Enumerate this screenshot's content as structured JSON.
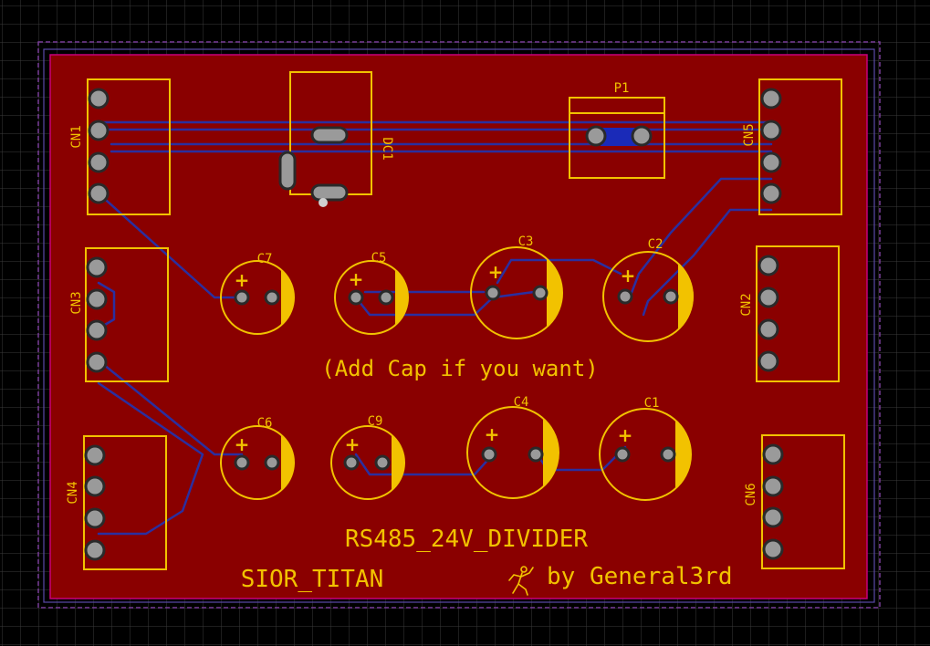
{
  "board": {
    "title": "RS485_24V_DIVIDER",
    "project": "SIOR_TITAN",
    "author": "by General3rd",
    "note": "(Add Cap if you want)",
    "logo_icon": "running-figure-icon"
  },
  "connectors": [
    "CN1",
    "CN2",
    "CN3",
    "CN4",
    "CN5",
    "CN6"
  ],
  "capacitors": [
    "C1",
    "C2",
    "C3",
    "C4",
    "C5",
    "C6",
    "C7",
    "C9"
  ],
  "components": {
    "dc_converter": "DC1",
    "header": "P1"
  },
  "polarity_mark": "+",
  "colors": {
    "background": "#000000",
    "grid": "#3a3a3a",
    "copper_pour": "#8a0000",
    "silkscreen": "#f2c200",
    "trace": "#2a2fa0",
    "outline": "#7a3f9a",
    "pad": "#9a9a9a"
  }
}
